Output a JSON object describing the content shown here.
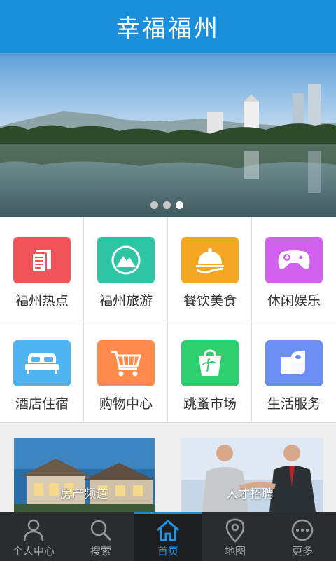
{
  "header": {
    "title": "幸福福州"
  },
  "banner": {
    "slide_count": 3,
    "active_slide": 3
  },
  "categories": [
    {
      "label": "福州热点",
      "icon": "news-icon",
      "color": "#f2545b"
    },
    {
      "label": "福州旅游",
      "icon": "mountain-icon",
      "color": "#2ec5a4"
    },
    {
      "label": "餐饮美食",
      "icon": "food-cloche-icon",
      "color": "#f5a623"
    },
    {
      "label": "休闲娱乐",
      "icon": "gamepad-icon",
      "color": "#d361f0"
    },
    {
      "label": "酒店住宿",
      "icon": "bed-icon",
      "color": "#4fb4f0"
    },
    {
      "label": "购物中心",
      "icon": "shopping-cart-icon",
      "color": "#ff8a4c"
    },
    {
      "label": "跳蚤市场",
      "icon": "shopping-bag-icon",
      "color": "#2ecf6e"
    },
    {
      "label": "生活服务",
      "icon": "toilet-paper-icon",
      "color": "#6c8ff5"
    }
  ],
  "promos": [
    {
      "label": "房产频道"
    },
    {
      "label": "人才招聘"
    }
  ],
  "tabbar": {
    "items": [
      {
        "label": "个人中心",
        "icon": "person-icon"
      },
      {
        "label": "搜索",
        "icon": "search-icon"
      },
      {
        "label": "首页",
        "icon": "home-icon",
        "active": true
      },
      {
        "label": "地图",
        "icon": "map-pin-icon"
      },
      {
        "label": "更多",
        "icon": "more-icon"
      }
    ]
  }
}
